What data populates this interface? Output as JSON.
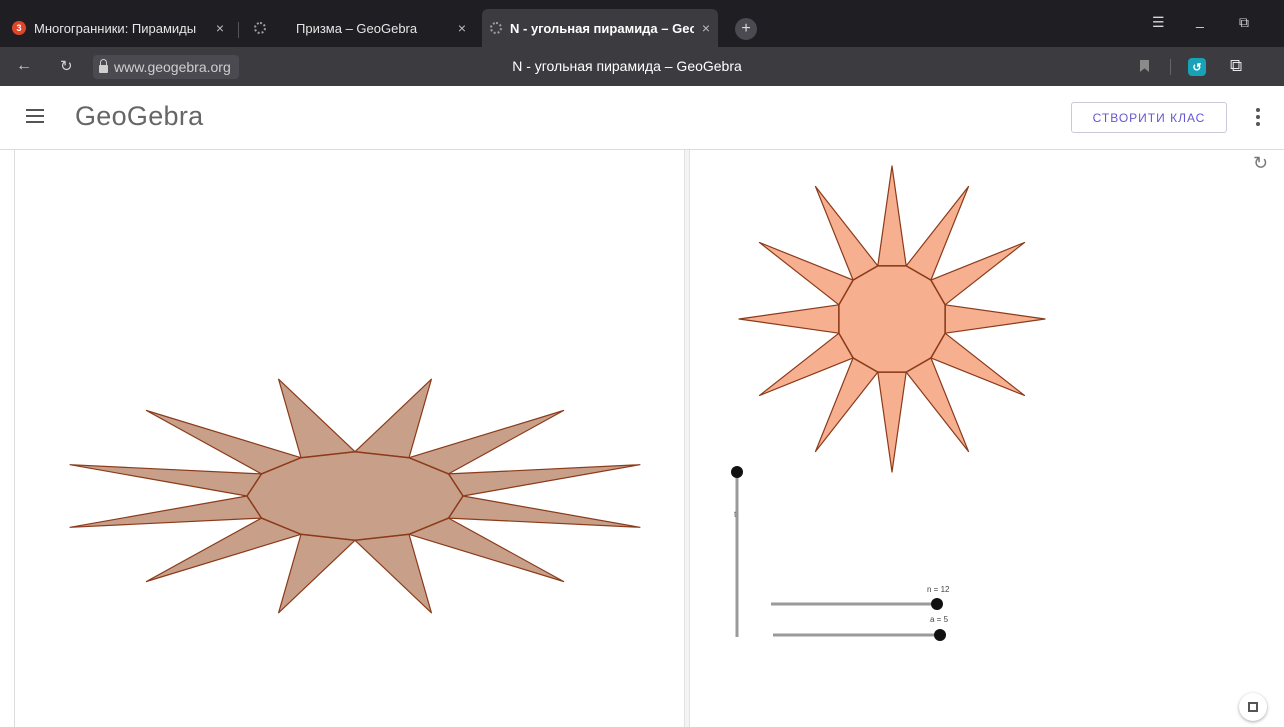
{
  "browser": {
    "tabs": [
      {
        "label": "Многогранники: Пирамиды",
        "favicon": "opera-red-icon",
        "active": false
      },
      {
        "label": "Призма – GeoGebra",
        "favicon": "loading-icon",
        "active": false
      },
      {
        "label": "N - угольная пирамида – GeoGebra",
        "favicon": "loading-icon",
        "active": true
      }
    ],
    "tab_close_glyph": "×",
    "new_tab_glyph": "+",
    "url": "www.geogebra.org",
    "page_title": "N - угольная пирамида – GeoGebra",
    "window_controls": [
      "menu-icon",
      "minimize-icon",
      "restore-icon"
    ]
  },
  "ggb_header": {
    "logo_text": "GeoGebra",
    "create_class_label": "СТВОРИТИ КЛАС"
  },
  "applet": {
    "left_view": {
      "fill": "#c8a08a",
      "stroke": "#8b3a1a",
      "polygon_sides": 12
    },
    "right_view": {
      "fill": "#f6b08f",
      "stroke": "#8b3a1a",
      "polygon_sides": 12
    },
    "sliders": [
      {
        "label": "n = 12",
        "name": "n",
        "value": 12
      },
      {
        "label": "a = 5",
        "name": "a",
        "value": 5
      }
    ],
    "vertical_slider": {
      "label": "t"
    }
  },
  "colors": {
    "chrome_dark": "#1f1f23",
    "chrome_mid": "#3b3b40",
    "ggb_purple": "#6557d2"
  }
}
